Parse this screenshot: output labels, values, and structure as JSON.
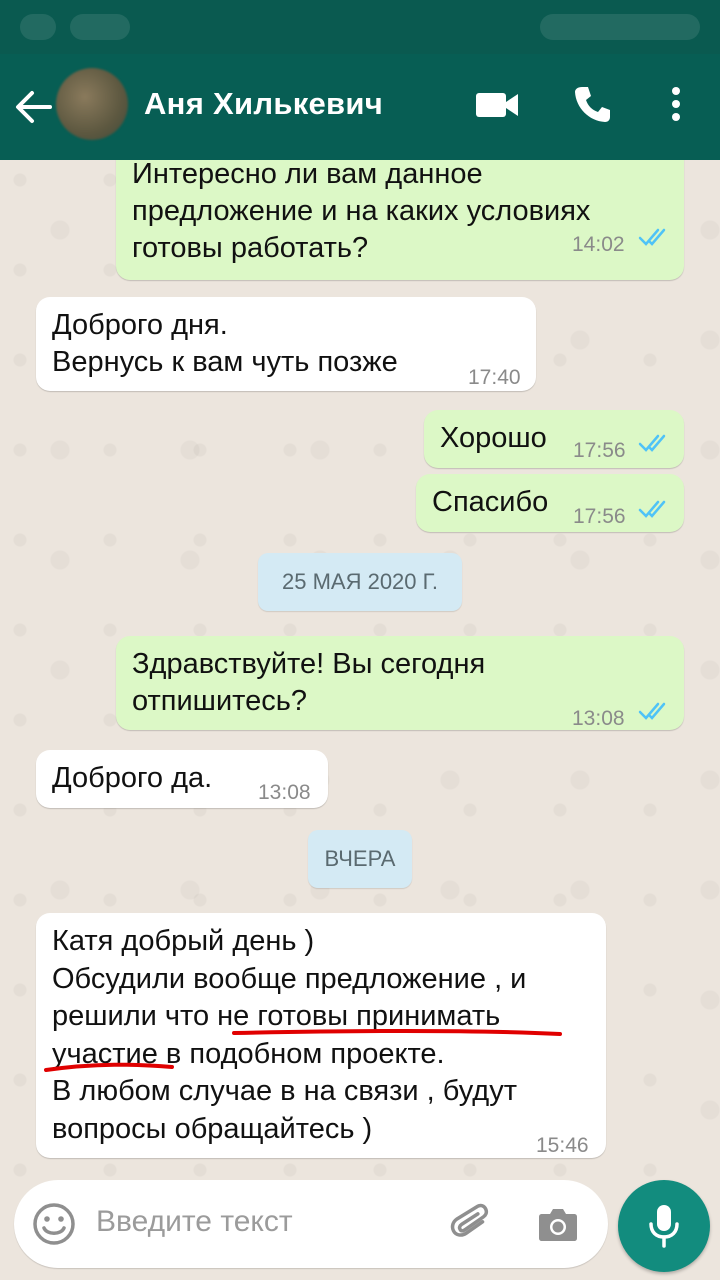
{
  "header": {
    "contact_name": "Аня Хилькевич"
  },
  "messages": [
    {
      "dir": "out",
      "text": "Интересно ли вам данное\nпредложение и на каких условиях\nготовы работать?",
      "time": "14:02"
    },
    {
      "dir": "in",
      "text": "Доброго дня.\nВернусь к вам чуть позже",
      "time": "17:40"
    },
    {
      "dir": "out",
      "text": "Хорошо",
      "time": "17:56"
    },
    {
      "dir": "out",
      "text": "Спасибо",
      "time": "17:56"
    },
    {
      "date": "25 МАЯ 2020 Г."
    },
    {
      "dir": "out",
      "text": "Здравствуйте! Вы сегодня\nотпишитесь?",
      "time": "13:08"
    },
    {
      "dir": "in",
      "text": "Доброго да.",
      "time": "13:08"
    },
    {
      "date": "ВЧЕРА"
    },
    {
      "dir": "in",
      "text": "Катя добрый день )\nОбсудили вообще предложение , и\nрешили что не готовы принимать\nучастие в подобном проекте.\nВ любом случае в на связи , будут\nвопросы обращайтесь )",
      "time": "15:46"
    }
  ],
  "input": {
    "placeholder": "Введите текст"
  },
  "colors": {
    "header": "#075e54",
    "outgoing": "#dcf8c6",
    "incoming": "#ffffff",
    "read_ticks": "#4fc3f7",
    "annotation": "#e00000",
    "mic_button": "#128c7e"
  },
  "icons": [
    "back-arrow-icon",
    "video-call-icon",
    "phone-icon",
    "more-vert-icon",
    "emoji-icon",
    "attach-icon",
    "camera-icon",
    "mic-icon"
  ]
}
